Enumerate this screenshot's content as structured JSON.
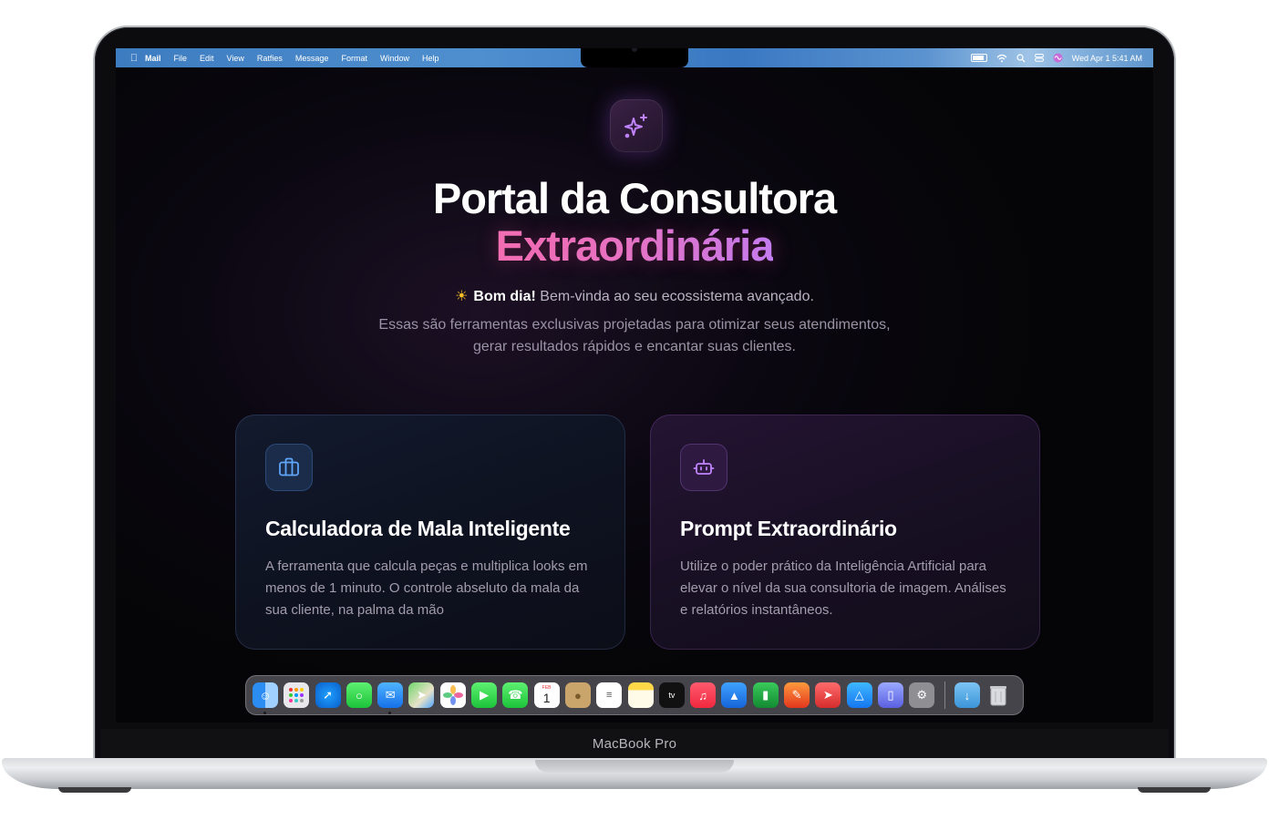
{
  "device": {
    "label": "MacBook Pro"
  },
  "menubar": {
    "app_name": "Mail",
    "items": [
      "File",
      "Edit",
      "View",
      "Ratfies",
      "Message",
      "Format",
      "Window",
      "Help"
    ],
    "datetime": "Wed Apr 1  5:41 AM"
  },
  "hero": {
    "icon": "sparkles-icon",
    "title": "Portal da Consultora",
    "subtitle": "Extraordinária",
    "greeting_bold": "Bom dia!",
    "greeting_rest": " Bem-vinda ao seu ecossistema avançado.",
    "description": "Essas são ferramentas exclusivas projetadas para otimizar seus atendimentos, gerar resultados rápidos e encantar suas clientes."
  },
  "cards": [
    {
      "icon": "briefcase-icon",
      "title": "Calculadora de Mala Inteligente",
      "text": "A ferramenta que calcula peças e multiplica looks em menos de 1 minuto. O controle abseluto da mala da sua cliente, na palma da mão"
    },
    {
      "icon": "bot-icon",
      "title": "Prompt Extraordinário",
      "text": "Utilize o poder prático da Inteligência Artificial para elevar o nível da sua consultoria de imagem. Análises e relatórios instantâneos."
    }
  ],
  "colors": {
    "accent_pink": "#f472b6",
    "accent_purple": "#c084fc",
    "accent_blue": "#60a5fa"
  },
  "dock": {
    "calendar_month": "FEB",
    "calendar_day": "1",
    "tv_label": "tv"
  }
}
